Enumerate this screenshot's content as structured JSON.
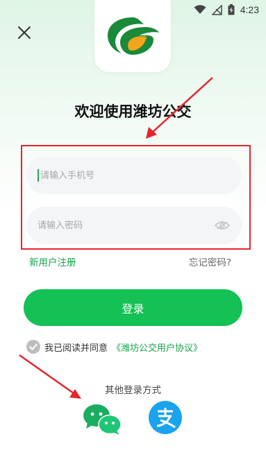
{
  "status_bar": {
    "time": "4:23",
    "icons": [
      "wifi-icon",
      "no-signal-icon",
      "battery-charging-icon"
    ]
  },
  "header": {
    "close_icon": "close-icon",
    "logo_icon": "weifang-bus-logo"
  },
  "welcome": {
    "title": "欢迎使用潍坊公交"
  },
  "form": {
    "phone_placeholder": "请输入手机号",
    "password_placeholder": "请输入密码",
    "password_toggle_icon": "eye-hidden-icon"
  },
  "links": {
    "register": "新用户注册",
    "forgot_password": "忘记密码?"
  },
  "login_button": "登录",
  "agreement": {
    "prefix": "我已阅读并同意",
    "link": "《潍坊公交用户协议》"
  },
  "other_login": {
    "label": "其他登录方式",
    "options": [
      "wechat-icon",
      "alipay-icon"
    ]
  },
  "colors": {
    "primary_green": "#14c154",
    "link_green": "#16a34a",
    "annotation_red": "#e3242b",
    "logo_green": "#1a8a3a",
    "logo_orange": "#f2a51c",
    "alipay_blue": "#1aa3ee",
    "wechat_green": "#1aad62"
  }
}
